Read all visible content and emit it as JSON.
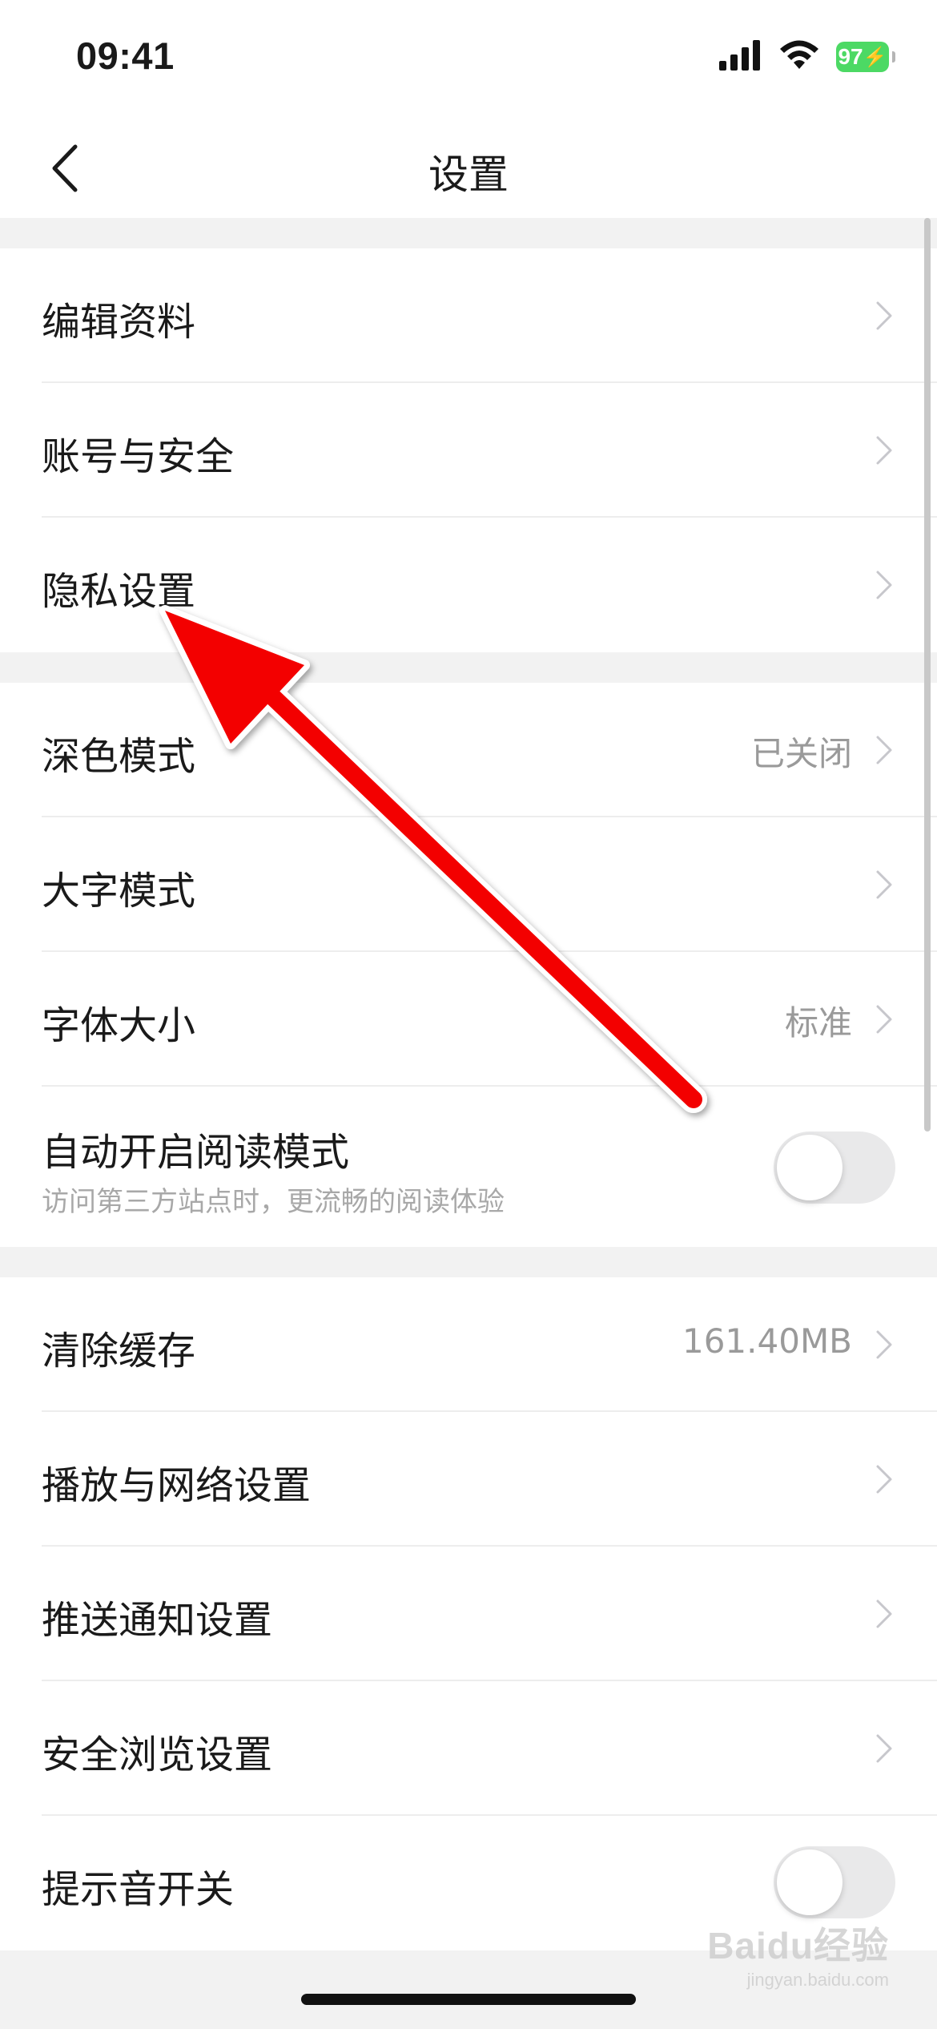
{
  "status_bar": {
    "time": "09:41",
    "battery_level": "97",
    "icons": [
      "cellular-signal-icon",
      "wifi-icon",
      "battery-charging-icon"
    ]
  },
  "nav": {
    "title": "设置",
    "back_icon": "chevron-left-icon"
  },
  "groups": [
    {
      "items": [
        {
          "label": "编辑资料"
        },
        {
          "label": "账号与安全"
        },
        {
          "label": "隐私设置"
        }
      ]
    },
    {
      "items": [
        {
          "label": "深色模式",
          "value": "已关闭"
        },
        {
          "label": "大字模式"
        },
        {
          "label": "字体大小",
          "value": "标准"
        },
        {
          "label": "自动开启阅读模式",
          "subtitle": "访问第三方站点时，更流畅的阅读体验",
          "toggle_on": false
        }
      ]
    },
    {
      "items": [
        {
          "label": "清除缓存",
          "value": "161.40MB"
        },
        {
          "label": "播放与网络设置"
        },
        {
          "label": "推送通知设置"
        },
        {
          "label": "安全浏览设置"
        },
        {
          "label": "提示音开关",
          "toggle_on": false
        }
      ]
    }
  ],
  "annotation": {
    "color": "#f30000",
    "points_to": "隐私设置"
  },
  "watermark": {
    "logo": "Baidu经验",
    "url": "jingyan.baidu.com"
  },
  "colors": {
    "background_gap": "#f2f2f2",
    "secondary_text": "#9a9a9a",
    "toggle_off": "#e9e9ea",
    "battery": "#4cd964"
  }
}
